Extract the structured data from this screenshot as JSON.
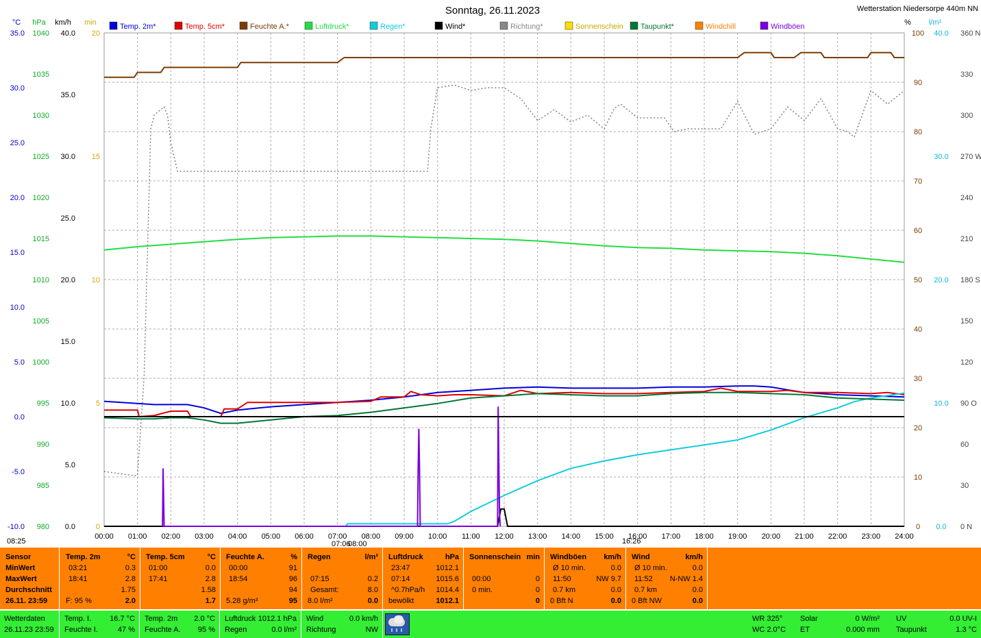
{
  "title": "Sonntag, 26.11.2023",
  "station": "Wetterstation Niedersorpe 440m NN",
  "axis_units": {
    "temp": "°C",
    "pressure": "hPa",
    "wind": "km/h",
    "sun": "min",
    "humidity": "%",
    "rain": "l/m²"
  },
  "legend": [
    {
      "label": "Temp. 2m*",
      "color": "#0000dd"
    },
    {
      "label": "Temp. 5cm*",
      "color": "#dd0000"
    },
    {
      "label": "Feuchte A.*",
      "color": "#7a3c00"
    },
    {
      "label": "Luftdruck*",
      "color": "#22dd44"
    },
    {
      "label": "Regen*",
      "color": "#11ccdd"
    },
    {
      "label": "Wind*",
      "color": "#000000"
    },
    {
      "label": "Richtung*",
      "color": "#888888"
    },
    {
      "label": "Sonnenschein",
      "color": "#ffdd00"
    },
    {
      "label": "Taupunkt*",
      "color": "#007733"
    },
    {
      "label": "Windchill",
      "color": "#ff8000"
    },
    {
      "label": "Windböen",
      "color": "#7a00dd"
    }
  ],
  "time_markers": {
    "sunrise": "08:25",
    "sunset": "16:26",
    "dawn": "07:06",
    "dawn2": "08:00"
  },
  "chart_data": {
    "type": "line",
    "xlabel": "",
    "ylabel": "",
    "x_ticks": [
      "00:00",
      "01:00",
      "02:00",
      "03:00",
      "04:00",
      "05:00",
      "06:00",
      "07:00",
      "08:00",
      "09:00",
      "10:00",
      "11:00",
      "12:00",
      "13:00",
      "14:00",
      "15:00",
      "16:00",
      "17:00",
      "18:00",
      "19:00",
      "20:00",
      "21:00",
      "22:00",
      "23:00",
      "24:00"
    ],
    "y_axes": {
      "temp": {
        "ticks": [
          "35.0",
          "30.0",
          "25.0",
          "20.0",
          "15.0",
          "10.0",
          "5.0",
          "0.0",
          "-5.0",
          "-10.0"
        ],
        "range": [
          -10,
          35
        ]
      },
      "pressure": {
        "ticks": [
          "1040",
          "1035",
          "1030",
          "1025",
          "1020",
          "1015",
          "1010",
          "1005",
          "1000",
          "995",
          "990",
          "985",
          "980"
        ],
        "range": [
          980,
          1040
        ]
      },
      "wind": {
        "ticks": [
          "40.0",
          "35.0",
          "30.0",
          "25.0",
          "20.0",
          "15.0",
          "10.0",
          "5.0",
          "0.0"
        ],
        "range": [
          0,
          40
        ]
      },
      "sun": {
        "ticks": [
          "20",
          "15",
          "10",
          "5",
          "0"
        ],
        "range": [
          0,
          20
        ]
      },
      "humidity": {
        "ticks": [
          "100",
          "90",
          "80",
          "70",
          "60",
          "50",
          "40",
          "30",
          "20",
          "10",
          "0"
        ],
        "range": [
          0,
          100
        ]
      },
      "rain": {
        "ticks": [
          "40.0",
          "30.0",
          "20.0",
          "10.0",
          "0.0"
        ],
        "range": [
          0,
          40
        ]
      },
      "direction": {
        "ticks": [
          "360 N",
          "330",
          "300",
          "270 W",
          "240",
          "210",
          "180 S",
          "150",
          "120",
          "90 O",
          "60",
          "30",
          "0 N"
        ],
        "range": [
          0,
          360
        ]
      }
    },
    "series": [
      {
        "name": "Temp. 2m*",
        "axis": "temp",
        "color": "#0000dd",
        "x": [
          0,
          1,
          1.5,
          2,
          2.5,
          3,
          3.5,
          4,
          5,
          6,
          7,
          8,
          9,
          10,
          11,
          12,
          13,
          14,
          15,
          16,
          17,
          18,
          19,
          19.5,
          20,
          21,
          22,
          23,
          24
        ],
        "y": [
          1.4,
          1.2,
          1.1,
          1.1,
          1.1,
          0.8,
          0.3,
          0.6,
          0.9,
          1.1,
          1.3,
          1.5,
          1.8,
          2.2,
          2.4,
          2.6,
          2.7,
          2.6,
          2.6,
          2.6,
          2.7,
          2.7,
          2.8,
          2.8,
          2.7,
          2.2,
          2.0,
          1.9,
          1.8
        ]
      },
      {
        "name": "Temp. 5cm*",
        "axis": "temp",
        "color": "#dd0000",
        "x": [
          0,
          1,
          1.05,
          1.5,
          2,
          2.5,
          2.6,
          3,
          3.5,
          3.6,
          4,
          4.3,
          5,
          6,
          7,
          8,
          8.3,
          9,
          9.2,
          9.5,
          10,
          10.5,
          11,
          12,
          12.5,
          13,
          14,
          15,
          16,
          17,
          18,
          18.5,
          19,
          20,
          20.5,
          21,
          22,
          23,
          23.5,
          24
        ],
        "y": [
          0.6,
          0.6,
          0.0,
          0.1,
          0.5,
          0.5,
          0.0,
          0.0,
          0.0,
          0.7,
          0.7,
          1.3,
          1.3,
          1.3,
          1.3,
          1.4,
          1.8,
          1.8,
          2.3,
          2.0,
          1.9,
          2.0,
          2.0,
          1.9,
          2.4,
          2.1,
          2.2,
          2.1,
          2.1,
          2.2,
          2.3,
          2.6,
          2.3,
          2.3,
          2.4,
          2.2,
          2.2,
          2.1,
          2.2,
          2.0
        ]
      },
      {
        "name": "Feuchte A.*",
        "axis": "humidity",
        "color": "#7a3c00",
        "x": [
          0,
          0.9,
          1.0,
          1.7,
          1.8,
          4.0,
          4.1,
          7.0,
          7.2,
          7.7,
          7.8,
          19.0,
          19.2,
          20.0,
          20.1,
          20.7,
          20.9,
          21.5,
          21.6,
          22.9,
          23.0,
          23.6,
          23.7,
          24
        ],
        "y": [
          91,
          91,
          92,
          92,
          93,
          93,
          94,
          94,
          95,
          95,
          95,
          95,
          96,
          96,
          95,
          95,
          96,
          96,
          95,
          95,
          96,
          96,
          95,
          95
        ]
      },
      {
        "name": "Luftdruck*",
        "axis": "pressure",
        "color": "#22dd44",
        "x": [
          0,
          1,
          2,
          3,
          4,
          5,
          6,
          7,
          8,
          9,
          10,
          11,
          12,
          13,
          14,
          15,
          16,
          17,
          18,
          19,
          20,
          21,
          22,
          23,
          24
        ],
        "y": [
          1013.6,
          1014.0,
          1014.3,
          1014.6,
          1014.9,
          1015.1,
          1015.2,
          1015.3,
          1015.3,
          1015.2,
          1015.1,
          1015.0,
          1014.9,
          1014.7,
          1014.4,
          1014.1,
          1013.9,
          1013.8,
          1013.6,
          1013.5,
          1013.4,
          1013.2,
          1012.9,
          1012.5,
          1012.1
        ]
      },
      {
        "name": "Regen*",
        "axis": "rain",
        "color": "#11ccdd",
        "x": [
          0,
          7.25,
          7.3,
          10.3,
          10.5,
          11.0,
          12.0,
          13.0,
          14.0,
          15.0,
          16.0,
          17.0,
          18.0,
          19.0,
          20.0,
          21.0,
          22.0,
          22.5,
          23.0,
          23.5,
          24
        ],
        "y": [
          0.0,
          0.0,
          0.2,
          0.2,
          0.4,
          1.2,
          2.5,
          3.7,
          4.7,
          5.3,
          5.8,
          6.2,
          6.6,
          7.0,
          7.8,
          8.8,
          9.6,
          10.1,
          10.4,
          10.6,
          10.8
        ]
      },
      {
        "name": "Wind*",
        "axis": "wind",
        "color": "#000000",
        "x": [
          0,
          11.8,
          11.9,
          12.0,
          12.1,
          24
        ],
        "y": [
          0,
          0,
          1.4,
          1.4,
          0,
          0
        ]
      },
      {
        "name": "Windböen",
        "axis": "wind",
        "color": "#7a00dd",
        "x": [
          1.75,
          1.77,
          1.8,
          9.4,
          9.42,
          9.44,
          9.46,
          9.48,
          11.8,
          11.82,
          11.84,
          11.86,
          11.88
        ],
        "y": [
          0,
          4.7,
          0,
          0,
          4.7,
          7.9,
          4.7,
          0,
          0,
          9.7,
          5.0,
          1.0,
          0
        ]
      },
      {
        "name": "Taupunkt*",
        "axis": "temp",
        "color": "#007733",
        "x": [
          0,
          1,
          1.5,
          2,
          2.5,
          3,
          3.5,
          4,
          5,
          6,
          7,
          8,
          9,
          10,
          11,
          12,
          13,
          14,
          15,
          16,
          17,
          18,
          19,
          20,
          21,
          22,
          23,
          24
        ],
        "y": [
          -0.1,
          -0.2,
          -0.2,
          -0.1,
          -0.1,
          -0.3,
          -0.6,
          -0.6,
          -0.3,
          0.0,
          0.1,
          0.4,
          0.8,
          1.2,
          1.7,
          1.9,
          2.1,
          2.0,
          1.9,
          1.9,
          2.1,
          2.2,
          2.2,
          2.1,
          2.0,
          1.7,
          1.6,
          1.5
        ]
      },
      {
        "name": "Richtung*",
        "axis": "direction",
        "color": "#808080",
        "x": [
          0,
          0.9,
          1.0,
          1.2,
          1.4,
          1.5,
          1.7,
          1.8,
          1.9,
          2.0,
          2.2,
          9.7,
          9.8,
          10.0,
          10.5,
          11.0,
          11.5,
          12.0,
          12.5,
          13.0,
          13.5,
          14.0,
          14.5,
          15.0,
          15.3,
          15.5,
          16.0,
          16.8,
          17.1,
          17.5,
          18.0,
          18.5,
          19.0,
          19.5,
          20.0,
          20.5,
          21.0,
          21.5,
          22.0,
          22.3,
          22.5,
          23.0,
          23.5,
          24
        ],
        "y": [
          40,
          37,
          37,
          110,
          290,
          300,
          304,
          306,
          300,
          280,
          259,
          259,
          290,
          320,
          322,
          318,
          320,
          320,
          312,
          296,
          304,
          295,
          300,
          290,
          305,
          308,
          298,
          298,
          288,
          290,
          290,
          290,
          310,
          286,
          290,
          306,
          296,
          312,
          290,
          288,
          284,
          318,
          308,
          318
        ]
      }
    ]
  },
  "stats": {
    "sensor": {
      "title": "Sensor",
      "rows": [
        "MinWert",
        "MaxWert",
        "Durchschnitt",
        "26.11. 23:59"
      ]
    },
    "temp2m": {
      "title": "Temp. 2m",
      "unit": "°C",
      "r1a": "03:21",
      "r1b": "0.3",
      "r2a": "18:41",
      "r2b": "2.8",
      "r3b": "1.75",
      "r4a": "F: 95 %",
      "r4b": "2.0"
    },
    "temp5cm": {
      "title": "Temp. 5cm",
      "unit": "°C",
      "r1a": "01:00",
      "r1b": "0.0",
      "r2a": "17:41",
      "r2b": "2.8",
      "r3b": "1.58",
      "r4b": "1.7"
    },
    "feuchte": {
      "title": "Feuchte A.",
      "unit": "%",
      "r1a": "00:00",
      "r1b": "91",
      "r2a": "18:54",
      "r2b": "96",
      "r3b": "94",
      "r4a": "5.28 g/m³",
      "r4b": "95"
    },
    "regen": {
      "title": "Regen",
      "unit": "l/m²",
      "r2a": "07:15",
      "r2b": "0.2",
      "r3a": "Gesamt:",
      "r3b": "8.0",
      "r4a": "8.0 l/m²",
      "r4b": "0.0"
    },
    "luftdruck": {
      "title": "Luftdruck",
      "unit": "hPa",
      "r1a": "23:47",
      "r1b": "1012.1",
      "r2a": "07:14",
      "r2b": "1015.6",
      "r3a": "^0.7hPa/h",
      "r3b": "1014.4",
      "r4a": "bewölkt",
      "r4b": "1012.1",
      "arrow": "🡻"
    },
    "sonne": {
      "title": "Sonnenschein",
      "unit": "min",
      "r2a": "00:00",
      "r2b": "0",
      "r3a": "0 min.",
      "r3b": "0",
      "r4b": "0"
    },
    "boeen": {
      "title": "Windböen",
      "unit": "km/h",
      "r1a": "Ø 10 min.",
      "r1b": "0.0",
      "r2a": "11:50",
      "r2b": "NW 9.7",
      "r3a": "0.7 km",
      "r3b": "0.0",
      "r4a": "0 Bft N",
      "r4b": "0.0"
    },
    "wind": {
      "title": "Wind",
      "unit": "km/h",
      "r1a": "Ø 10 min.",
      "r1b": "0.0",
      "r2a": "11:52",
      "r2b": "N-NW 1.4",
      "r3a": "0.7 km",
      "r3b": "0.0",
      "r4a": "0 Bft NW",
      "r4b": "0.0"
    }
  },
  "footer": {
    "l1": "Wetterdaten",
    "l2": "26.11.23 23:59",
    "ti_l": "Temp. I.",
    "ti_v": "16.7 °C",
    "fi_l": "Feuchte I.",
    "fi_v": "47 %",
    "ta_l": "Temp. 2m",
    "ta_v": "2.0 °C",
    "fa_l": "Feuchte A.",
    "fa_v": "95 %",
    "ld_l": "Luftdruck",
    "ld_v": "1012.1 hPa",
    "rg_l": "Regen",
    "rg_v": "0.0 l/m²",
    "wi_l": "Wind",
    "wi_v": "0.0 km/h",
    "ri_l": "Richtung",
    "ri_v": "NW",
    "wr": "WR 325°",
    "wc": "WC 2.0°C",
    "so_l": "Solar",
    "so_v": "0 W/m²",
    "et_l": "ET",
    "et_v": "0.000 mm",
    "uv_l": "UV",
    "uv_v": "0.0 UV-I",
    "tp_l": "Taupunkt",
    "tp_v": "1.3 °C",
    "weather_icon": "cloud-rain-icon"
  }
}
